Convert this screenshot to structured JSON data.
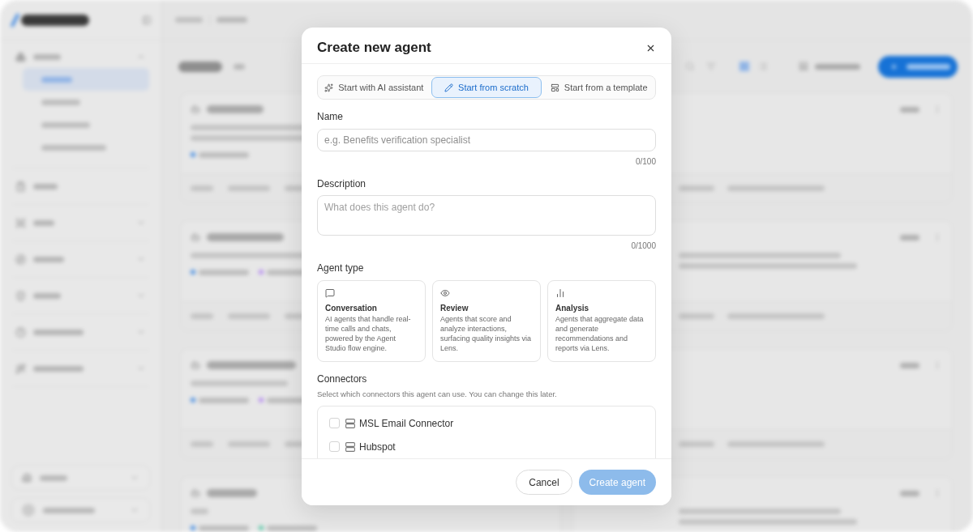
{
  "modal": {
    "title": "Create new agent",
    "start_options": [
      {
        "kind": "assistant",
        "label": "Start with AI assistant",
        "selected": false
      },
      {
        "kind": "scratch",
        "label": "Start from scratch",
        "selected": true
      },
      {
        "kind": "template",
        "label": "Start from a template",
        "selected": false
      }
    ],
    "name_field": {
      "label": "Name",
      "placeholder": "e.g. Benefits verification specialist",
      "counter": "0/100"
    },
    "description_field": {
      "label": "Description",
      "placeholder": "What does this agent do?",
      "counter": "0/1000"
    },
    "agent_type": {
      "label": "Agent type",
      "options": [
        {
          "kind": "conversation",
          "title": "Conversation",
          "description": "AI agents that handle real-time calls and chats, powered by the Agent Studio flow engine.",
          "selected": false
        },
        {
          "kind": "review",
          "title": "Review",
          "description": "Agents that score and analyze interactions, surfacing quality insights via Lens.",
          "selected": false
        },
        {
          "kind": "analysis",
          "title": "Analysis",
          "description": "Agents that aggregate data and generate recommendations and reports via Lens.",
          "selected": false
        }
      ]
    },
    "connectors": {
      "label": "Connectors",
      "hint": "Select which connectors this agent can use. You can change this later.",
      "items": [
        {
          "name": "MSL Email Connector",
          "checked": false
        },
        {
          "name": "Hubspot",
          "checked": false
        }
      ]
    },
    "buttons": {
      "cancel": "Cancel",
      "create": {
        "label": "Create agent",
        "disabled": true
      }
    }
  }
}
